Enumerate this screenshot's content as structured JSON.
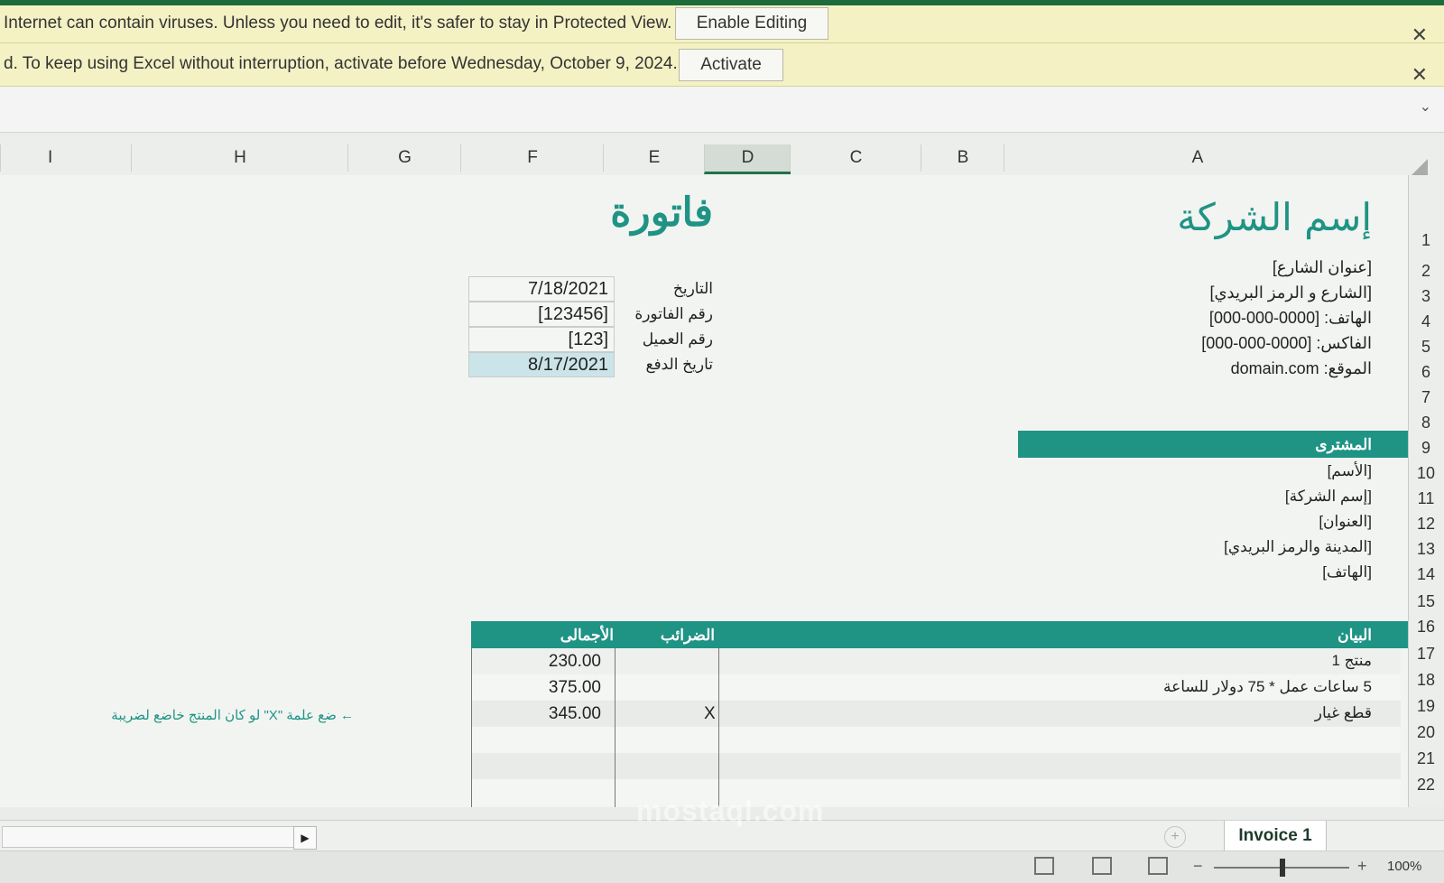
{
  "protected_bar": {
    "message": "Internet can contain viruses. Unless you need to edit, it's safer to stay in Protected View.",
    "button": "Enable Editing",
    "close": "✕"
  },
  "activation_bar": {
    "message": "d. To keep using Excel without interruption, activate before Wednesday, October 9, 2024.",
    "button": "Activate",
    "close": "✕"
  },
  "columns": [
    "I",
    "H",
    "G",
    "F",
    "E",
    "D",
    "C",
    "B",
    "A"
  ],
  "rows": [
    "1",
    "2",
    "3",
    "4",
    "5",
    "6",
    "7",
    "8",
    "9",
    "10",
    "11",
    "12",
    "13",
    "14",
    "15",
    "16",
    "17",
    "18",
    "19",
    "20",
    "21",
    "22"
  ],
  "company": {
    "name": "إسم الشركة",
    "street": "[عنوان الشارع]",
    "city_zip": "[الشارع و الرمز البريدي]",
    "phone": "الهاتف: [0000-000-000]",
    "fax": "الفاكس: [0000-000-000]",
    "website": "الموقع: domain.com"
  },
  "invoice": {
    "title": "فاتورة",
    "labels": [
      "التاريخ",
      "رقم الفاتورة",
      "رقم العميل",
      "تاريخ الدفع"
    ],
    "values": [
      "7/18/2021",
      "[123456]",
      "[123]",
      "8/17/2021"
    ]
  },
  "buyer": {
    "header": "المشترى",
    "lines": [
      "[الأسم]",
      "[إسم الشركة]",
      "[العنوان]",
      "[المدينة والرمز البريدي]",
      "[الهاتف]"
    ]
  },
  "items_table": {
    "headers": {
      "description": "البيان",
      "taxes": "الضرائب",
      "total": "الأجمالى"
    },
    "rows": [
      {
        "description": "منتج 1",
        "tax": "",
        "total": "230.00"
      },
      {
        "description": "5 ساعات عمل * 75 دولار للساعة",
        "tax": "",
        "total": "375.00"
      },
      {
        "description": "قطع غيار",
        "tax": "X",
        "total": "345.00"
      }
    ],
    "tax_note": "← ضع علمة \"X\" لو كان المنتج خاضع لضريبة"
  },
  "sheet_tab": "Invoice 1",
  "zoom": "100%",
  "watermark": "mostaql.com",
  "colors": {
    "teal": "#1f9384",
    "excel_green": "#217346"
  }
}
